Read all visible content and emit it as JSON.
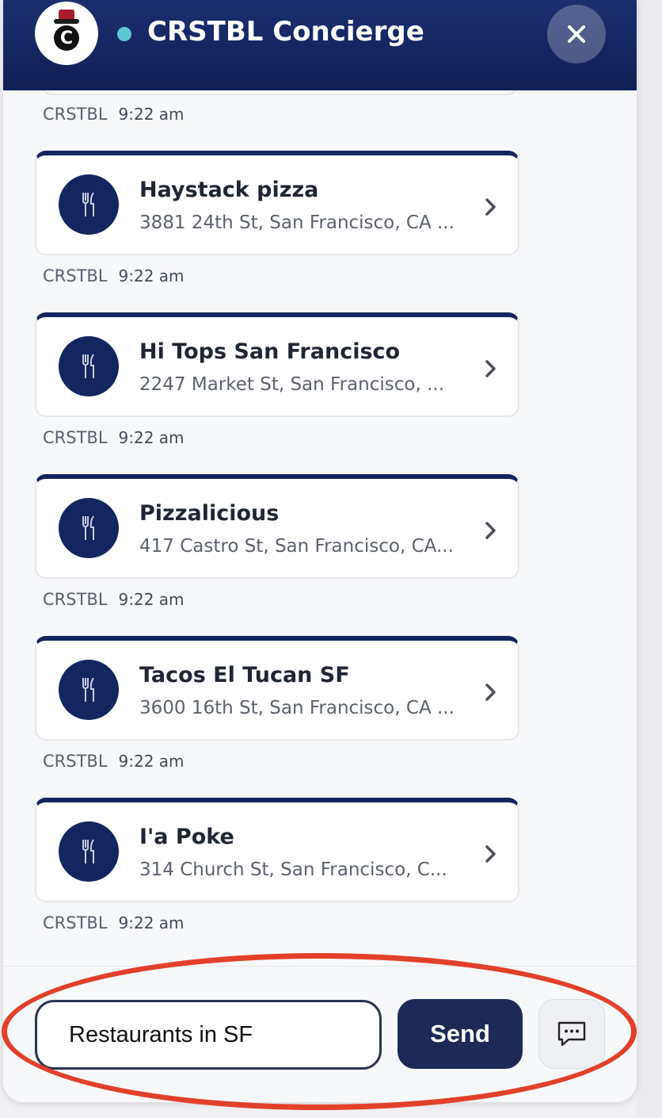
{
  "header": {
    "title": "CRSTBL Concierge",
    "logo_letter": "C",
    "status_color": "#5ec8d6",
    "brand_color": "#14245e"
  },
  "messages": {
    "first_meta": {
      "sender": "CRSTBL",
      "time": "9:22 am"
    },
    "cards": [
      {
        "name": "Haystack pizza",
        "address": "3881 24th St, San Francisco, CA ...",
        "icon": "fork-knife-icon",
        "meta": {
          "sender": "CRSTBL",
          "time": "9:22 am"
        }
      },
      {
        "name": "Hi Tops San Francisco",
        "address": "2247 Market St, San Francisco, ...",
        "icon": "fork-knife-icon",
        "meta": {
          "sender": "CRSTBL",
          "time": "9:22 am"
        }
      },
      {
        "name": "Pizzalicious",
        "address": "417 Castro St, San Francisco, CA...",
        "icon": "fork-knife-icon",
        "meta": {
          "sender": "CRSTBL",
          "time": "9:22 am"
        }
      },
      {
        "name": "Tacos El Tucan SF",
        "address": "3600 16th St, San Francisco, CA ...",
        "icon": "fork-knife-icon",
        "meta": {
          "sender": "CRSTBL",
          "time": "9:22 am"
        }
      },
      {
        "name": "I'a Poke",
        "address": "314 Church St, San Francisco, C...",
        "icon": "fork-knife-icon",
        "meta": {
          "sender": "CRSTBL",
          "time": "9:22 am"
        }
      }
    ]
  },
  "composer": {
    "input_value": "Restaurants in SF",
    "send_label": "Send",
    "chat_icon": "chat-bubble-icon"
  },
  "annotation": {
    "color": "#e3402b"
  }
}
